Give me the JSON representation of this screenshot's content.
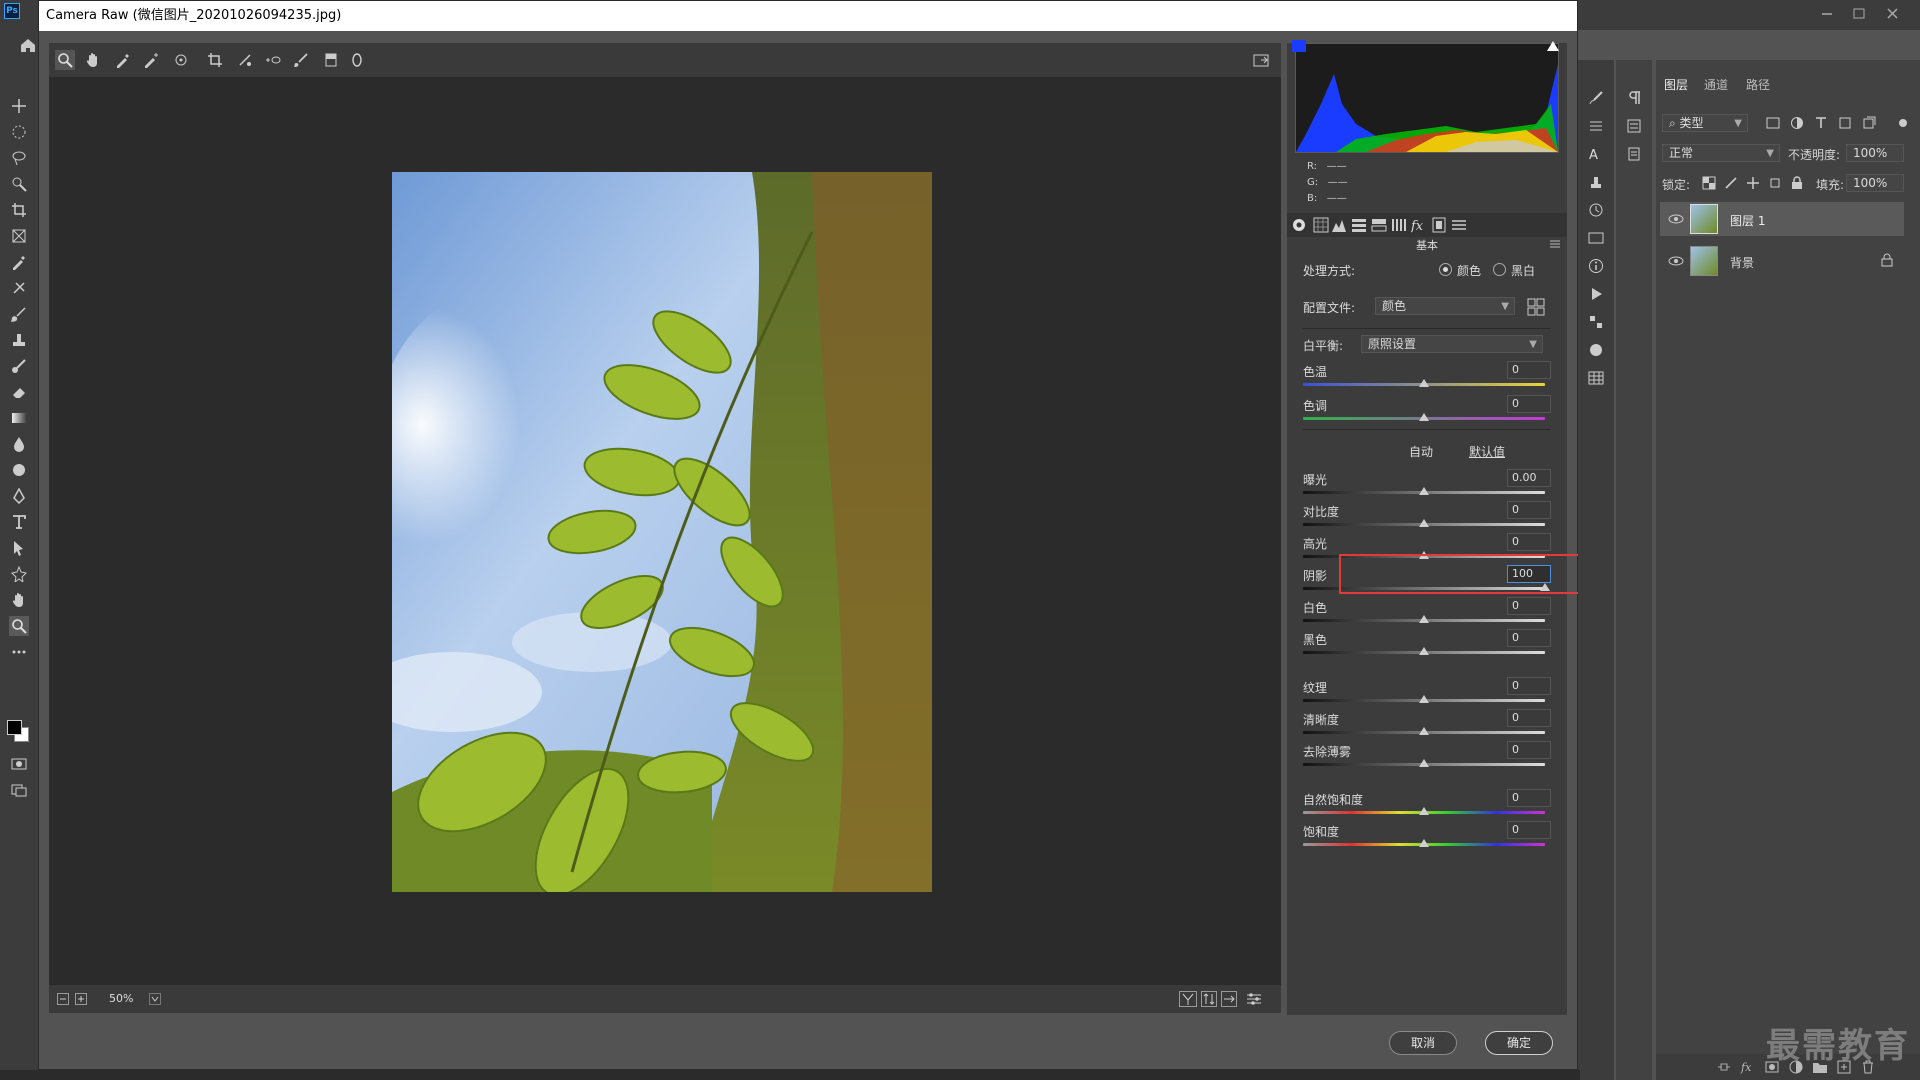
{
  "app": {
    "logo": "Ps"
  },
  "dialog": {
    "title": "Camera Raw (微信图片_20201026094235.jpg)",
    "zoom": "50%",
    "cancel": "取消",
    "ok": "确定"
  },
  "panel": {
    "rgb": {
      "r": "R:",
      "g": "G:",
      "b": "B:",
      "dash": "——"
    },
    "section": "基本",
    "treatment_label": "处理方式:",
    "treatment_color": "颜色",
    "treatment_bw": "黑白",
    "profile_label": "配置文件:",
    "profile_value": "颜色",
    "wb_label": "白平衡:",
    "wb_value": "原照设置",
    "auto": "自动",
    "default": "默认值",
    "sliders": [
      {
        "label": "色温",
        "value": "0",
        "pos": 0.5
      },
      {
        "label": "色调",
        "value": "0",
        "pos": 0.5
      },
      {
        "label": "曝光",
        "value": "0.00",
        "pos": 0.5
      },
      {
        "label": "对比度",
        "value": "0",
        "pos": 0.5
      },
      {
        "label": "高光",
        "value": "0",
        "pos": 0.5
      },
      {
        "label": "阴影",
        "value": "100",
        "pos": 1.0
      },
      {
        "label": "白色",
        "value": "0",
        "pos": 0.5
      },
      {
        "label": "黑色",
        "value": "0",
        "pos": 0.5
      },
      {
        "label": "纹理",
        "value": "0",
        "pos": 0.5
      },
      {
        "label": "清晰度",
        "value": "0",
        "pos": 0.5
      },
      {
        "label": "去除薄雾",
        "value": "0",
        "pos": 0.5
      },
      {
        "label": "自然饱和度",
        "value": "0",
        "pos": 0.5
      },
      {
        "label": "饱和度",
        "value": "0",
        "pos": 0.5
      }
    ]
  },
  "layers_panel": {
    "tabs": [
      "图层",
      "通道",
      "路径"
    ],
    "filter": "类型",
    "blend": "正常",
    "opacity_label": "不透明度:",
    "opacity": "100%",
    "lock_label": "锁定:",
    "fill_label": "填充:",
    "fill": "100%",
    "layers": [
      {
        "name": "图层 1"
      },
      {
        "name": "背景"
      }
    ]
  },
  "watermark": "最需教育",
  "colors": {
    "accent": "#31a8ff",
    "highlight": "#e23a3a",
    "panel": "#3c3c3c"
  }
}
